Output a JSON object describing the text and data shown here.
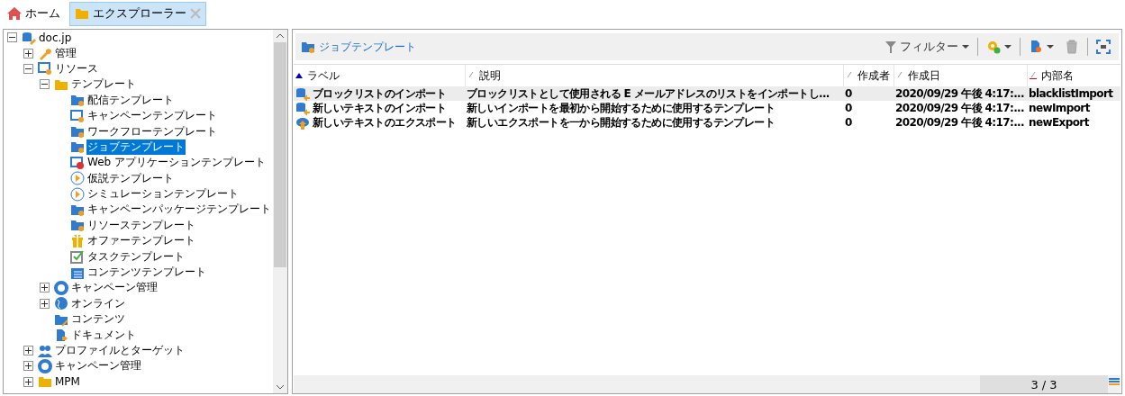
{
  "tabs": [
    {
      "label": "ホーム",
      "selected": false,
      "closable": false
    },
    {
      "label": "エクスプローラー",
      "selected": true,
      "closable": true
    }
  ],
  "tree": [
    {
      "label": "doc.jp",
      "expanded": true,
      "selected": false,
      "children": [
        {
          "label": "管理",
          "expanded": false,
          "selected": false
        },
        {
          "label": "リソース",
          "expanded": true,
          "selected": false,
          "children": [
            {
              "label": "テンプレート",
              "expanded": true,
              "selected": false,
              "children": [
                {
                  "label": "配信テンプレート",
                  "selected": false
                },
                {
                  "label": "キャンペーンテンプレート",
                  "selected": false
                },
                {
                  "label": "ワークフローテンプレート",
                  "selected": false
                },
                {
                  "label": "ジョブテンプレート",
                  "selected": true
                },
                {
                  "label": "Web アプリケーションテンプレート",
                  "selected": false
                },
                {
                  "label": "仮説テンプレート",
                  "selected": false
                },
                {
                  "label": "シミュレーションテンプレート",
                  "selected": false
                },
                {
                  "label": "キャンペーンパッケージテンプレート",
                  "selected": false
                },
                {
                  "label": "リソーステンプレート",
                  "selected": false
                },
                {
                  "label": "オファーテンプレート",
                  "selected": false
                },
                {
                  "label": "タスクテンプレート",
                  "selected": false
                },
                {
                  "label": "コンテンツテンプレート",
                  "selected": false
                }
              ]
            },
            {
              "label": "キャンペーン管理",
              "expanded": false,
              "selected": false
            },
            {
              "label": "オンライン",
              "expanded": false,
              "selected": false
            },
            {
              "label": "コンテンツ",
              "selected": false
            },
            {
              "label": "ドキュメント",
              "selected": false
            }
          ]
        },
        {
          "label": "プロファイルとターゲット",
          "expanded": false,
          "selected": false
        },
        {
          "label": "キャンペーン管理",
          "expanded": false,
          "selected": false
        },
        {
          "label": "MPM",
          "expanded": false,
          "selected": false
        }
      ]
    }
  ],
  "breadcrumb": "ジョブテンプレート",
  "toolbar": {
    "filter": "フィルター",
    "delete_disabled": true
  },
  "table": {
    "columns": [
      {
        "label": "ラベル",
        "sorted": true,
        "primary_key": false
      },
      {
        "label": "説明",
        "sorted": false,
        "primary_key": false
      },
      {
        "label": "作成者",
        "sorted": false,
        "primary_key": false
      },
      {
        "label": "作成日",
        "sorted": false,
        "primary_key": false
      },
      {
        "label": "内部名",
        "sorted": false,
        "primary_key": true
      }
    ],
    "rows": [
      {
        "selected": true,
        "kind": "import",
        "cells": [
          "ブロックリストのインポート",
          "ブロックリストとして使用される E メールアドレスのリストをインポートし...",
          "0",
          "2020/09/29 午後 4:17:...",
          "blacklistImport"
        ]
      },
      {
        "selected": false,
        "kind": "import",
        "cells": [
          "新しいテキストのインポート",
          "新しいインポートを最初から開始するために使用するテンプレート",
          "0",
          "2020/09/29 午後 4:17:...",
          "newImport"
        ]
      },
      {
        "selected": false,
        "kind": "export",
        "cells": [
          "新しいテキストのエクスポート",
          "新しいエクスポートを一から開始するために使用するテンプレート",
          "0",
          "2020/09/29 午後 4:17:...",
          "newExport"
        ]
      }
    ]
  },
  "status": "3 / 3"
}
